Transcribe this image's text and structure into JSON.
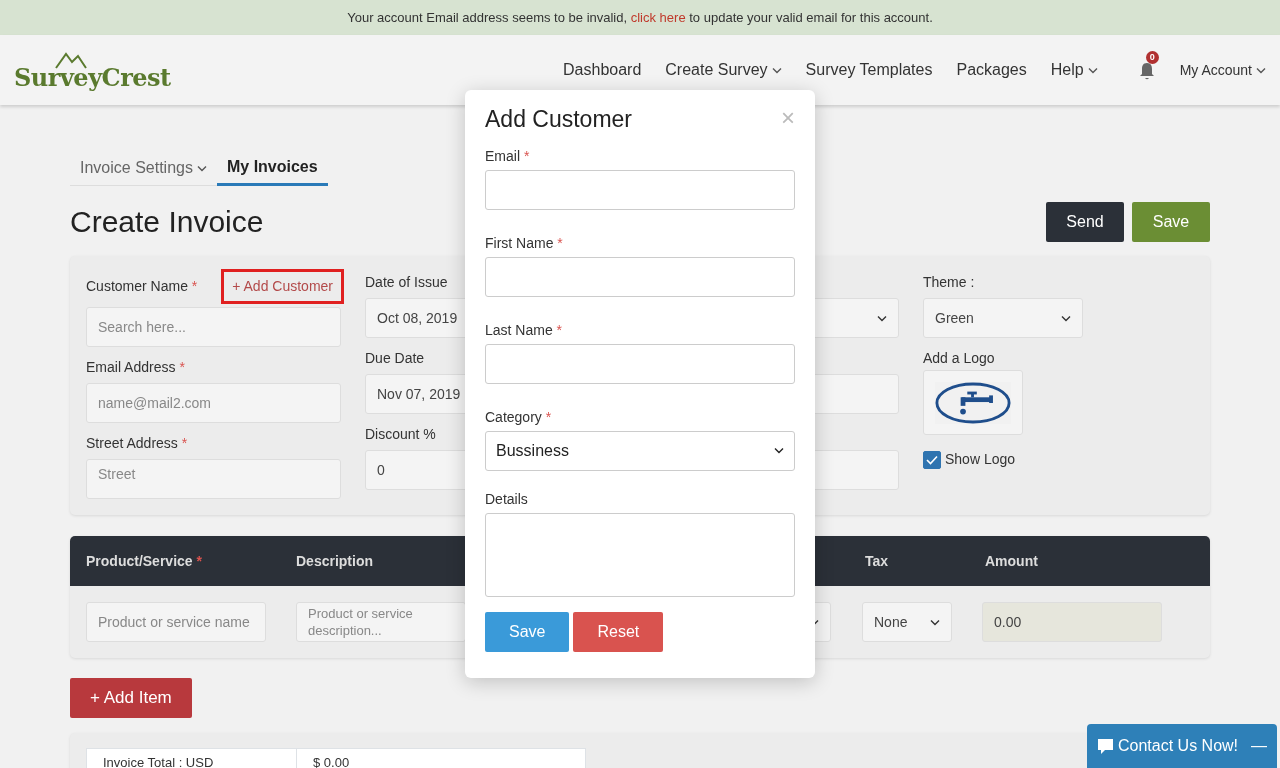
{
  "alert": {
    "before": "Your account Email address seems to be invalid, ",
    "link": "click here",
    "after": " to update your valid email for this account."
  },
  "navbar": {
    "brand": "SurveyCrest",
    "items": [
      {
        "label": "Dashboard",
        "dropdown": false
      },
      {
        "label": "Create Survey",
        "dropdown": true
      },
      {
        "label": "Survey Templates",
        "dropdown": false
      },
      {
        "label": "Packages",
        "dropdown": false
      },
      {
        "label": "Help",
        "dropdown": true
      }
    ],
    "notifications": "0",
    "account": {
      "label": "My Account",
      "dropdown": true
    }
  },
  "tabs": [
    {
      "label": "Invoice Settings",
      "dropdown": true,
      "selected": false
    },
    {
      "label": "My Invoices",
      "dropdown": false,
      "selected": true
    }
  ],
  "page_title": "Create Invoice",
  "actions": [
    {
      "label": "Send",
      "kind": "dark"
    },
    {
      "label": "Save",
      "kind": "success"
    }
  ],
  "customer": {
    "label": "Customer Name",
    "required_mark": "*",
    "add_link": "+ Add Customer",
    "add_link_highlighted": true,
    "placeholder": "Search here..."
  },
  "email": {
    "label": "Email Address",
    "required_mark": "*",
    "placeholder": "name@mail2.com"
  },
  "street": {
    "label": "Street Address",
    "required_mark": "*",
    "placeholder": "Street"
  },
  "dates": [
    {
      "label": "Date of Issue",
      "value": "Oct 08, 2019"
    },
    {
      "label": "Due Date",
      "value": "Nov 07, 2019"
    },
    {
      "label": "Discount %",
      "value": "0"
    }
  ],
  "theme": {
    "label": "Theme :",
    "value": "Green"
  },
  "logo": {
    "label": "Add a Logo",
    "show_label": "Show Logo",
    "show_checked": true
  },
  "items_table": {
    "columns": [
      {
        "label": "Product/Service",
        "required_mark": "*"
      },
      {
        "label": "Description"
      },
      {
        "label": "Tax"
      },
      {
        "label": "Amount"
      }
    ],
    "row": {
      "product_placeholder": "Product or service name",
      "description_placeholder": "Product or service description...",
      "tax": "None",
      "amount": "0.00"
    }
  },
  "add_item": "+ Add Item",
  "totals": {
    "label": "Invoice Total : USD",
    "value": "$ 0.00"
  },
  "modal": {
    "title": "Add Customer",
    "close": "×",
    "fields": [
      {
        "label": "Email",
        "required_mark": "*",
        "kind": "input"
      },
      {
        "label": "First Name",
        "required_mark": "*",
        "kind": "input"
      },
      {
        "label": "Last Name",
        "required_mark": "*",
        "kind": "input"
      },
      {
        "label": "Category",
        "required_mark": "*",
        "kind": "select",
        "value": "Bussiness"
      },
      {
        "label": "Details",
        "kind": "textarea"
      }
    ],
    "buttons": [
      {
        "label": "Save",
        "kind": "primary"
      },
      {
        "label": "Reset",
        "kind": "danger"
      }
    ]
  },
  "contact": {
    "label": "Contact Us Now!",
    "minimize": "—"
  }
}
